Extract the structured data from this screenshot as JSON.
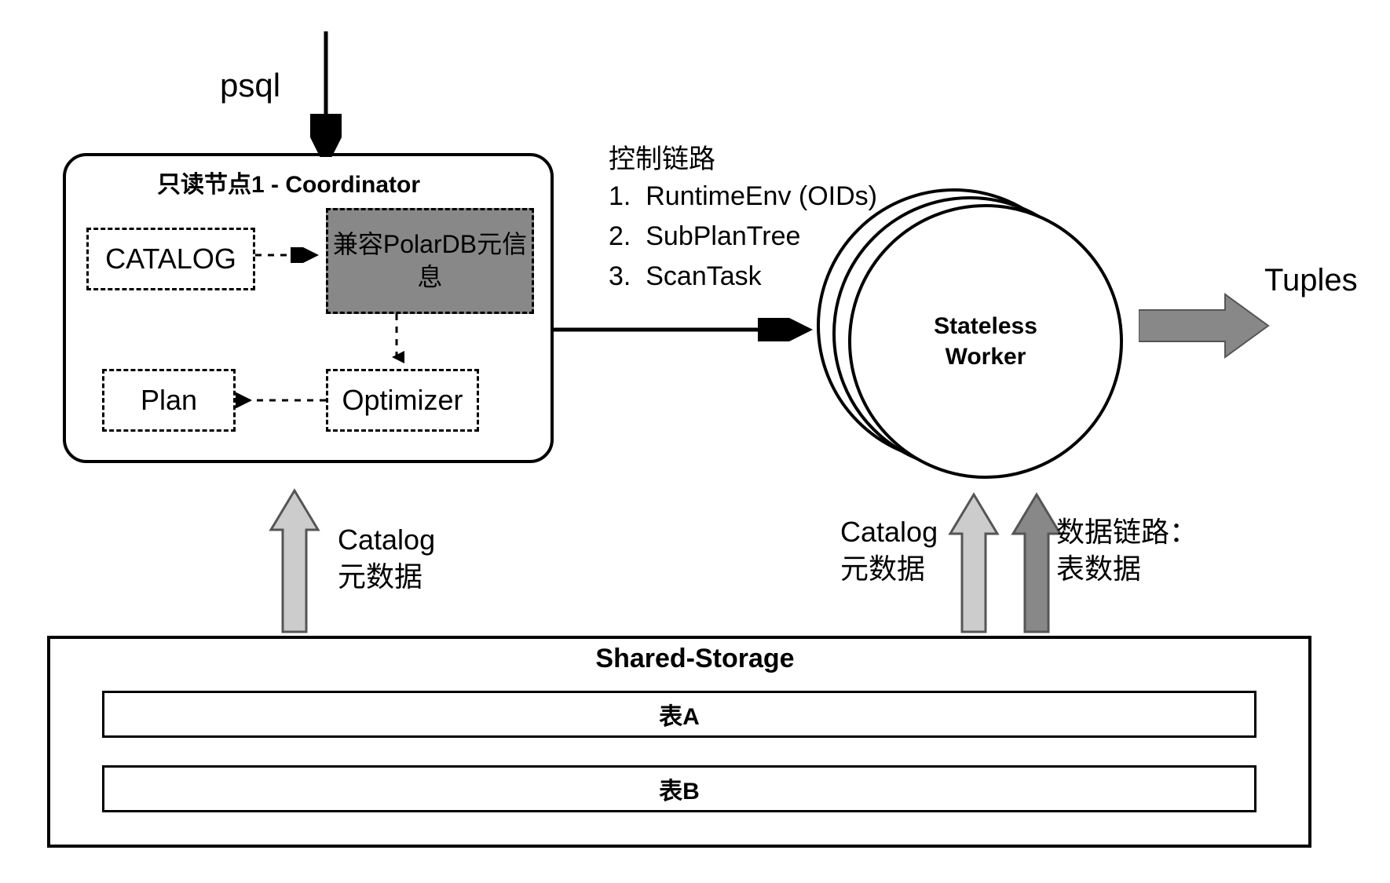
{
  "psql_label": "psql",
  "coordinator": {
    "title": "只读节点1 - Coordinator",
    "catalog": "CATALOG",
    "polardb": "兼容PolarDB元信息",
    "optimizer": "Optimizer",
    "plan": "Plan"
  },
  "control_path": {
    "title": "控制链路",
    "items": [
      "RuntimeEnv (OIDs)",
      "SubPlanTree",
      "ScanTask"
    ]
  },
  "worker_label": "Stateless Worker",
  "tuples_label": "Tuples",
  "catalog_meta": {
    "line1": "Catalog",
    "line2": "元数据"
  },
  "data_path": {
    "line1": "数据链路：",
    "line2": "表数据"
  },
  "shared_storage": {
    "title": "Shared-Storage",
    "tables": [
      "表A",
      "表B"
    ]
  }
}
